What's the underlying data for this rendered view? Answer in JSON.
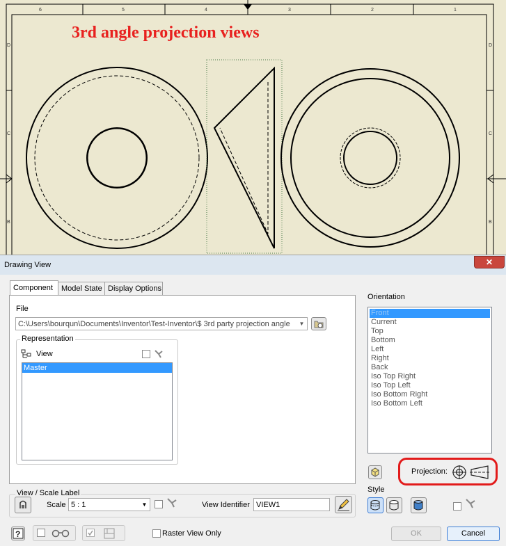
{
  "sheet": {
    "annotation": "3rd angle projection views",
    "top_zone_numbers": [
      "6",
      "5",
      "4",
      "3",
      "2",
      "1"
    ],
    "side_zone_letters": [
      "D",
      "C",
      "B"
    ]
  },
  "dialog": {
    "title": "Drawing View",
    "close_label": "✕",
    "tabs": [
      "Component",
      "Model State",
      "Display Options"
    ],
    "file_label": "File",
    "file_path": "C:\\Users\\bourqun\\Documents\\Inventor\\Test-Inventor\\$ 3rd party projection angle",
    "representation_label": "Representation",
    "view_label": "View",
    "rep_items": [
      "Master"
    ],
    "orientation_label": "Orientation",
    "orientations": [
      "Front",
      "Current",
      "Top",
      "Bottom",
      "Left",
      "Right",
      "Back",
      "Iso Top Right",
      "Iso Top Left",
      "Iso Bottom Right",
      "Iso Bottom Left"
    ],
    "projection_label": "Projection:",
    "view_scale_label_title": "View / Scale Label",
    "scale_label": "Scale",
    "scale_value": "5 : 1",
    "view_identifier_label": "View Identifier",
    "view_identifier_value": "VIEW1",
    "style_label": "Style",
    "raster_label": "Raster View Only",
    "ok_label": "OK",
    "cancel_label": "Cancel"
  }
}
